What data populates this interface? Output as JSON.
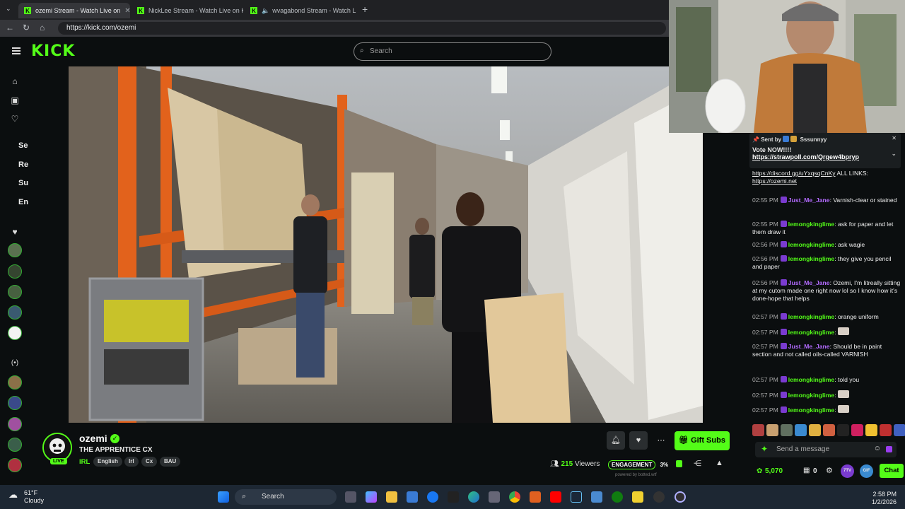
{
  "browser": {
    "tabs": [
      {
        "label": "ozemi Stream - Watch Live on",
        "active": true
      },
      {
        "label": "NickLee Stream - Watch Live on K",
        "active": false
      },
      {
        "label": "wvagabond Stream - Watch L",
        "active": false
      }
    ],
    "url": "https://kick.com/ozemi"
  },
  "header": {
    "logo": "KICK",
    "search_placeholder": "Search"
  },
  "sidebar": {
    "section_labels": [
      "Se",
      "Re",
      "Su",
      "En"
    ]
  },
  "channel": {
    "name": "ozemi",
    "live_label": "LIVE",
    "stream_title": "THE APPRENTICE CX",
    "category": "IRL",
    "tags": [
      "English",
      "Irl",
      "Cx",
      "BAU"
    ],
    "gift_subs_label": "Gift Subs",
    "viewers_count": "215",
    "viewers_label": "Viewers",
    "engagement_label": "ENGAGEMENT",
    "engagement_value": "3%",
    "powered_by": "powered by botted.wtf"
  },
  "chat": {
    "pinned": {
      "sent_by_label": "Sent by",
      "sender": "Sssunnyy",
      "line1": "Vote NOW!!!!",
      "link": "https://strawpoll.com/Qrgew4bpryp"
    },
    "top_fragment": {
      "link1": "https://discord.gg/uYxqsqCnKy",
      "text": " ALL LINKS:",
      "link2": "https://ozemi.net"
    },
    "messages": [
      {
        "time": "02:55 PM",
        "user": "Just_Me_Jane",
        "color": "#b36bff",
        "text": "Varnish-clear or stained"
      },
      {
        "time": "02:55 PM",
        "user": "lemongkinglime",
        "color": "#53fc18",
        "text": "ask for paper and let them draw it"
      },
      {
        "time": "02:56 PM",
        "user": "lemongkinglime",
        "color": "#53fc18",
        "text": "ask wagie"
      },
      {
        "time": "02:56 PM",
        "user": "lemongkinglime",
        "color": "#53fc18",
        "text": "they give you pencil and paper"
      },
      {
        "time": "02:56 PM",
        "user": "Just_Me_Jane",
        "color": "#b36bff",
        "text": "Ozemi, I'm litreally sitting at my cutom made one right now lol so I know how it's done-hope that helps"
      },
      {
        "time": "02:57 PM",
        "user": "lemongkinglime",
        "color": "#53fc18",
        "text": "orange uniform"
      },
      {
        "time": "02:57 PM",
        "user": "lemongkinglime",
        "color": "#53fc18",
        "text": ""
      },
      {
        "time": "02:57 PM",
        "user": "Just_Me_Jane",
        "color": "#b36bff",
        "text": "Should be in paint section and not called oils-called VARNISH"
      },
      {
        "time": "02:57 PM",
        "user": "lemongkinglime",
        "color": "#53fc18",
        "text": "told you"
      },
      {
        "time": "02:57 PM",
        "user": "lemongkinglime",
        "color": "#53fc18",
        "text": ""
      },
      {
        "time": "02:57 PM",
        "user": "lemongkinglime",
        "color": "#53fc18",
        "text": ""
      }
    ],
    "input_placeholder": "Send a message",
    "points": "5,070",
    "crates": "0",
    "chat_button": "Chat",
    "badge_7tv": "7TV",
    "badge_gif": "GIF"
  },
  "taskbar": {
    "temp": "61°F",
    "condition": "Cloudy",
    "search_label": "Search",
    "time": "2:58 PM",
    "date": "1/2/2026"
  },
  "colors": {
    "kick_green": "#53fc18",
    "purple_user": "#b36bff",
    "bg": "#0b0e0f"
  }
}
